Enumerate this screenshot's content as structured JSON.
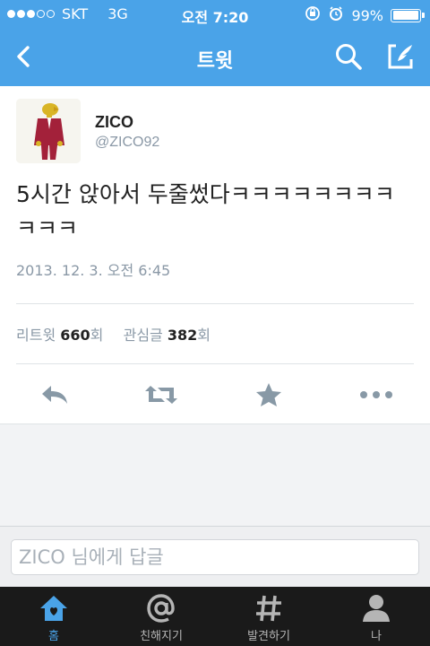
{
  "status_bar": {
    "carrier": "SKT",
    "network": "3G",
    "time": "오전 7:20",
    "battery": "99%",
    "battery_level": 0.99
  },
  "nav": {
    "title": "트윗",
    "icons": [
      "back-chevron-icon",
      "search-icon",
      "compose-icon"
    ]
  },
  "tweet": {
    "name": "ZICO",
    "handle": "@ZICO92",
    "text": "5시간 앉아서 두줄썼다ㅋㅋㅋㅋㅋㅋㅋㅋㅋㅋㅋ",
    "timestamp": "2013. 12. 3. 오전 6:45",
    "retweet_label": "리트윗",
    "retweet_count": "660",
    "retweet_suffix": "회",
    "favorite_label": "관심글",
    "favorite_count": "382",
    "favorite_suffix": "회",
    "actions": [
      "reply-icon",
      "retweet-icon",
      "favorite-star-icon",
      "more-icon"
    ]
  },
  "reply": {
    "placeholder": "ZICO 님에게 답글"
  },
  "tabs": [
    {
      "label": "홈",
      "icon": "home-icon",
      "active": true
    },
    {
      "label": "친해지기",
      "icon": "at-icon",
      "active": false
    },
    {
      "label": "발견하기",
      "icon": "hashtag-icon",
      "active": false
    },
    {
      "label": "나",
      "icon": "person-icon",
      "active": false
    }
  ],
  "colors": {
    "accent": "#4aa3e8",
    "tab_bar": "#1a1a1a",
    "muted_text": "#8a98a6",
    "action_icon": "#8899a6"
  }
}
